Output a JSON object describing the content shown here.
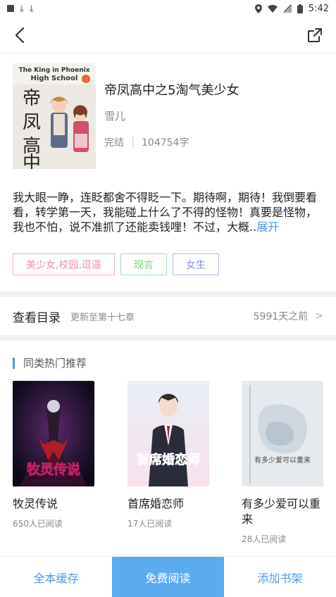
{
  "status_bar": {
    "time": "5:42"
  },
  "book": {
    "title": "帝凤高中之5淘气美少女",
    "author": "雪儿",
    "status": "完结",
    "word_count": "104754字",
    "cover_text_en": "The King in Phoenix High School",
    "cover_text_zh": "帝凤高中"
  },
  "description": {
    "text": "我大眼一睁，连眨都舍不得眨一下。期待啊，期待！我倒要看看，转学第一天，我能碰上什么了不得的怪物！真要是怪物，我也不怕，说不准抓了还能卖钱哩！不过，大概..",
    "expand_label": "展开"
  },
  "tags": [
    {
      "label": "美少女,校园,逗逼",
      "color": "#f08cb0"
    },
    {
      "label": "现言",
      "color": "#7ccf7c"
    },
    {
      "label": "女生",
      "color": "#7b8ee8"
    }
  ],
  "catalog": {
    "title": "查看目录",
    "latest": "更新至第十七章",
    "time": "5991天之前",
    "arrow": ">"
  },
  "recommend": {
    "title": "同类热门推荐",
    "items": [
      {
        "name": "牧灵传说",
        "readers": "650人已阅读",
        "cover_text": "牧灵传说"
      },
      {
        "name": "首席婚恋师",
        "readers": "17人已阅读",
        "cover_text": "首席婚恋师"
      },
      {
        "name": "有多少爱可以重来",
        "readers": "28人已阅读",
        "cover_text": "有多少爱可以重来"
      }
    ]
  },
  "bottom_bar": {
    "cache_label": "全本缓存",
    "read_label": "免费阅读",
    "shelf_label": "添加书架"
  },
  "colors": {
    "accent": "#4a9be8",
    "primary_button": "#5aacee"
  }
}
